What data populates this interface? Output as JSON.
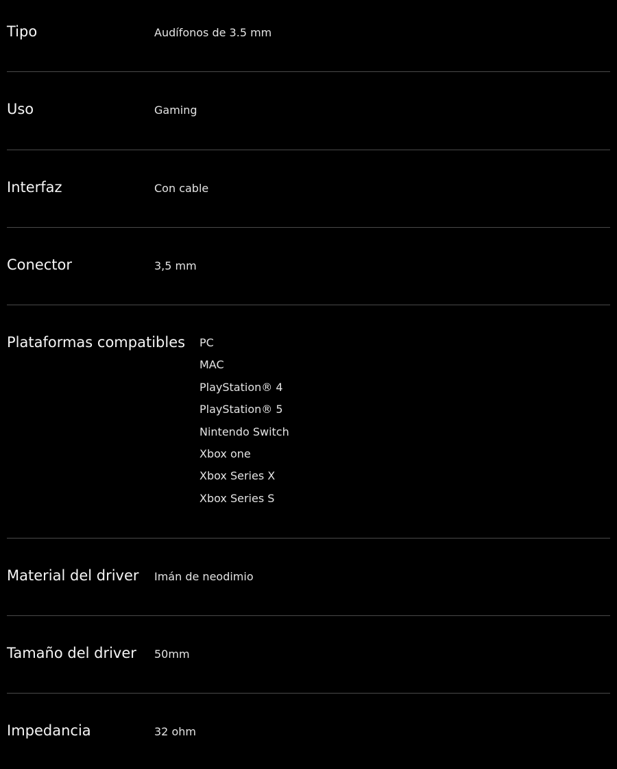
{
  "specs": [
    {
      "label": "Tipo",
      "value": "Audífonos de 3.5 mm"
    },
    {
      "label": "Uso",
      "value": "Gaming"
    },
    {
      "label": "Interfaz",
      "value": "Con cable"
    },
    {
      "label": "Conector",
      "value": "3,5 mm"
    },
    {
      "label": "Plataformas compatibles",
      "values": [
        "PC",
        "MAC",
        "PlayStation® 4",
        "PlayStation® 5",
        "Nintendo Switch",
        "Xbox one",
        "Xbox Series X",
        "Xbox Series S"
      ]
    },
    {
      "label": "Material del driver",
      "value": "Imán de neodimio"
    },
    {
      "label": "Tamaño del driver",
      "value": "50mm"
    },
    {
      "label": "Impedancia",
      "value": "32 ohm"
    }
  ]
}
